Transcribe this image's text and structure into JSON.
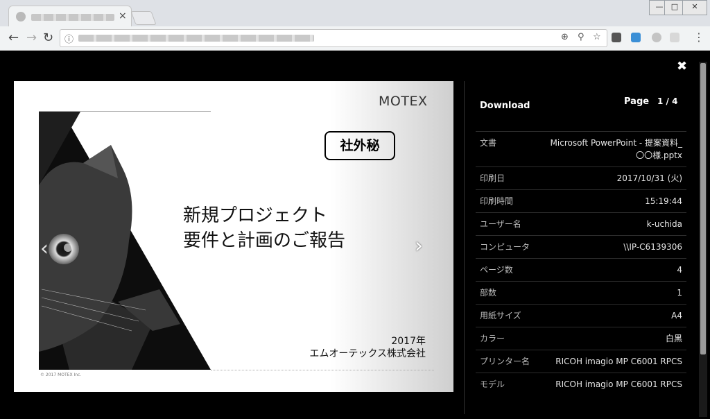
{
  "browser": {
    "tab_close": "×",
    "back": "←",
    "forward": "→",
    "reload": "↻",
    "info_icon": "ⓘ",
    "menu": "⋮",
    "window": {
      "minimize": "—",
      "maximize": "□",
      "close": "✕"
    }
  },
  "viewer": {
    "close": "✖",
    "prev": "‹",
    "next": "›",
    "slide": {
      "brand": "MOTEX",
      "confidential": "社外秘",
      "title_line1": "新規プロジェクト",
      "title_line2": "要件と計画のご報告",
      "year": "2017年",
      "company": "エムオーテックス株式会社",
      "copyright": "© 2017 MOTEX Inc."
    },
    "panel": {
      "download": "Download",
      "page_label": "Page",
      "page_value": "1 / 4",
      "rows": [
        {
          "key": "文書",
          "value": "Microsoft PowerPoint - 提案資料_〇〇様.pptx"
        },
        {
          "key": "印刷日",
          "value": "2017/10/31 (火)"
        },
        {
          "key": "印刷時間",
          "value": "15:19:44"
        },
        {
          "key": "ユーザー名",
          "value": "k-uchida"
        },
        {
          "key": "コンピュータ",
          "value": "\\\\IP-C6139306"
        },
        {
          "key": "ページ数",
          "value": "4"
        },
        {
          "key": "部数",
          "value": "1"
        },
        {
          "key": "用紙サイズ",
          "value": "A4"
        },
        {
          "key": "カラー",
          "value": "白黒"
        },
        {
          "key": "プリンター名",
          "value": "RICOH imagio MP C6001 RPCS"
        },
        {
          "key": "モデル",
          "value": "RICOH imagio MP C6001 RPCS"
        }
      ]
    }
  }
}
